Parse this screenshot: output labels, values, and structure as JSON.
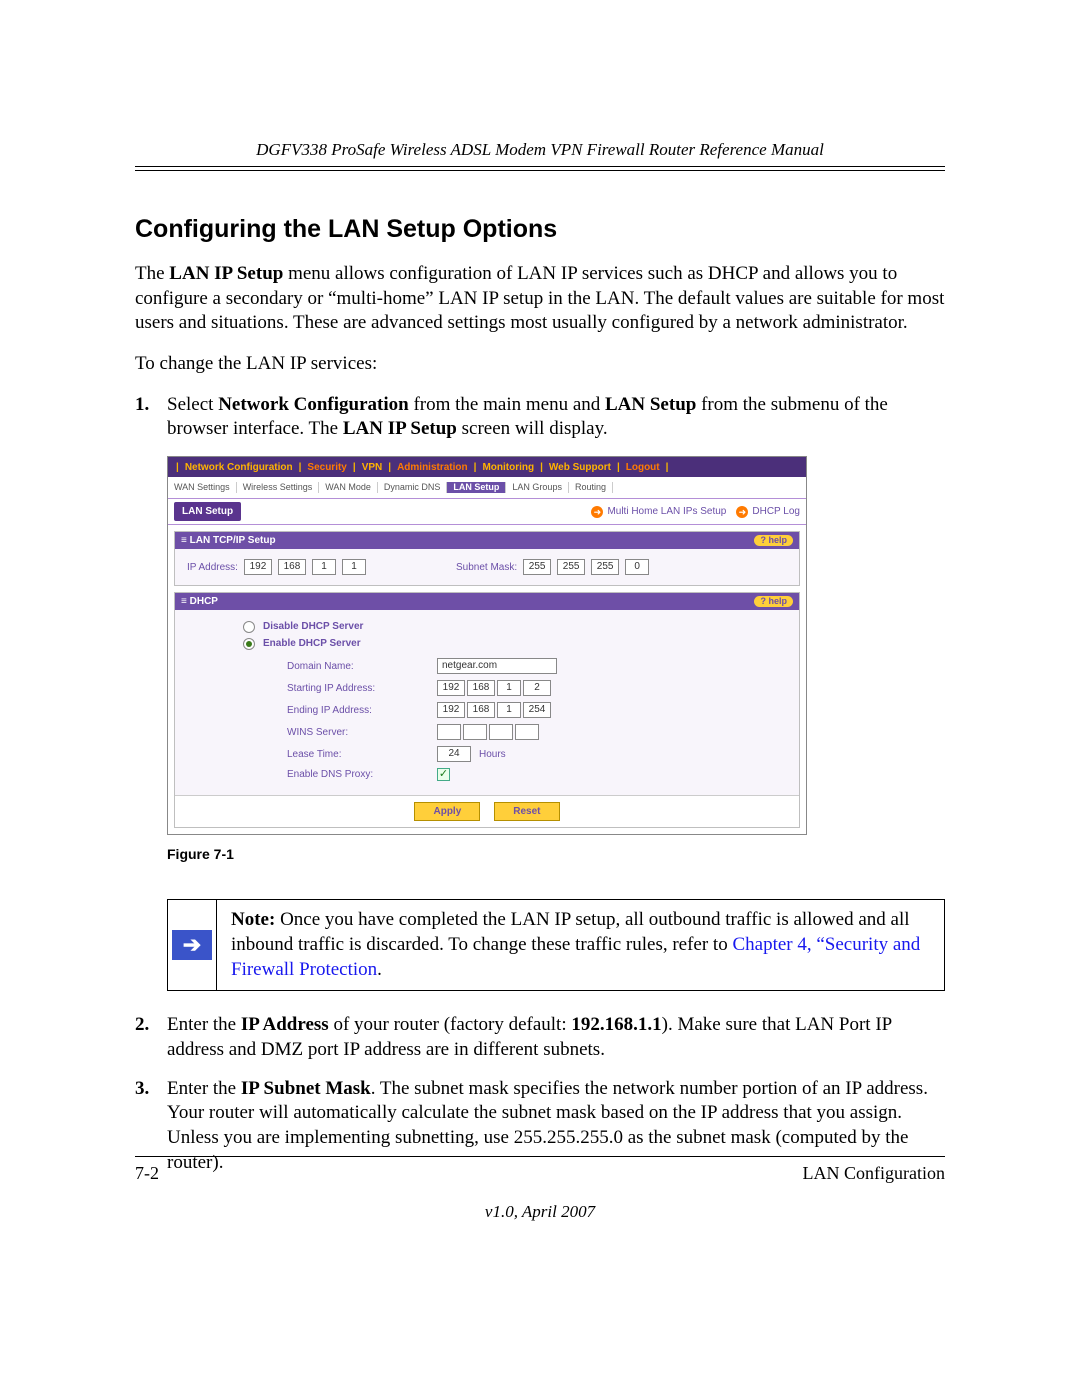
{
  "manual_title": "DGFV338 ProSafe Wireless ADSL Modem VPN Firewall Router Reference Manual",
  "section_heading": "Configuring the LAN Setup Options",
  "intro_para_pre": "The ",
  "intro_bold1": "LAN IP Setup",
  "intro_para_post": " menu allows configuration of LAN IP services such as DHCP and allows you to configure a secondary or “multi-home” LAN IP setup in the LAN. The default values are suitable for most users and situations. These are advanced settings most usually configured by a network administrator.",
  "lead_line": "To change the LAN IP services:",
  "step1_num": "1.",
  "step1_pre": "Select ",
  "step1_b1": "Network Configuration",
  "step1_mid1": " from the main menu and ",
  "step1_b2": "LAN Setup",
  "step1_mid2": " from the submenu of the browser interface. The ",
  "step1_b3": "LAN IP Setup",
  "step1_post": " screen will display.",
  "figure_caption": "Figure 7-1",
  "note_bold": "Note:",
  "note_text": " Once you have completed the LAN IP setup, all outbound traffic is allowed and all inbound traffic is discarded. To change these traffic rules, refer to ",
  "note_link": "Chapter 4, “Security and Firewall Protection",
  "note_tail": ".",
  "step2_num": "2.",
  "step2_pre": "Enter the ",
  "step2_b1": "IP Address",
  "step2_mid": " of your router (factory default: ",
  "step2_b2": "192.168.1.1",
  "step2_post": "). Make sure that LAN Port IP address and DMZ port IP address are in different subnets.",
  "step3_num": "3.",
  "step3_pre": "Enter the ",
  "step3_b1": "IP Subnet Mask",
  "step3_post": ". The subnet mask specifies the network number portion of an IP address. Your router will automatically calculate the subnet mask based on the IP address that you assign. Unless you are implementing subnetting, use 255.255.255.0 as the subnet mask (computed by the router).",
  "footer_left": "7-2",
  "footer_right": "LAN Configuration",
  "footer_version": "v1.0, April 2007",
  "ui": {
    "main_tabs": [
      "Network Configuration",
      "Security",
      "VPN",
      "Administration",
      "Monitoring",
      "Web Support",
      "Logout"
    ],
    "sub_tabs": [
      "WAN Settings",
      "Wireless Settings",
      "WAN Mode",
      "Dynamic DNS",
      "LAN Setup",
      "LAN Groups",
      "Routing"
    ],
    "chip": "LAN Setup",
    "right_links": [
      "Multi Home LAN IPs Setup",
      "DHCP Log"
    ],
    "panel1_title": "LAN TCP/IP Setup",
    "help": "help",
    "ip_label": "IP Address:",
    "ip_oct": [
      "192",
      "168",
      "1",
      "1"
    ],
    "mask_label": "Subnet Mask:",
    "mask_oct": [
      "255",
      "255",
      "255",
      "0"
    ],
    "panel2_title": "DHCP",
    "radio_disable": "Disable DHCP Server",
    "radio_enable": "Enable DHCP Server",
    "fields": {
      "domain_label": "Domain Name:",
      "domain_value": "netgear.com",
      "start_label": "Starting IP Address:",
      "start_oct": [
        "192",
        "168",
        "1",
        "2"
      ],
      "end_label": "Ending IP Address:",
      "end_oct": [
        "192",
        "168",
        "1",
        "254"
      ],
      "wins_label": "WINS Server:",
      "wins_oct": [
        "",
        "",
        "",
        ""
      ],
      "lease_label": "Lease Time:",
      "lease_value": "24",
      "lease_unit": "Hours",
      "dns_label": "Enable DNS Proxy:"
    },
    "btn_apply": "Apply",
    "btn_reset": "Reset"
  }
}
